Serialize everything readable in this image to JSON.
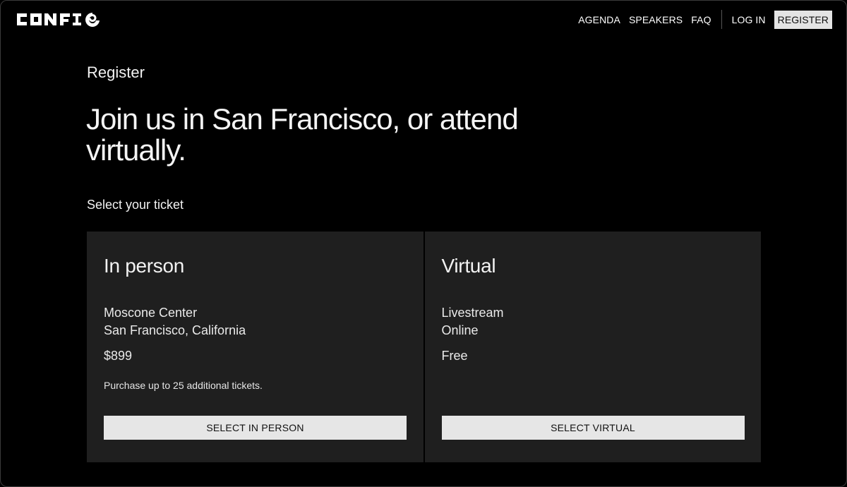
{
  "brand": {
    "logo_text": "CONFIG"
  },
  "nav": {
    "links": [
      "AGENDA",
      "SPEAKERS",
      "FAQ"
    ],
    "login": "LOG IN",
    "register": "REGISTER"
  },
  "hero": {
    "eyebrow": "Register",
    "headline": "Join us in San Francisco, or attend virtually."
  },
  "tickets": {
    "label": "Select your ticket",
    "cards": [
      {
        "title": "In person",
        "location_line1": "Moscone Center",
        "location_line2": "San Francisco, California",
        "price": "$899",
        "note": "Purchase up to 25 additional tickets.",
        "button": "SELECT IN PERSON"
      },
      {
        "title": "Virtual",
        "location_line1": "Livestream",
        "location_line2": "Online",
        "price": "Free",
        "note": "",
        "button": "SELECT VIRTUAL"
      }
    ]
  },
  "colors": {
    "background": "#000000",
    "card": "#1f1f1f",
    "button": "#e6e6e6",
    "text": "#ffffff"
  }
}
